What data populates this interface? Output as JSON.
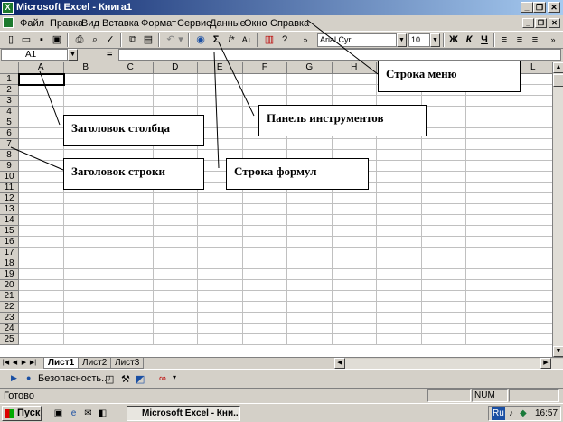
{
  "window": {
    "title": "Microsoft Excel - Книга1",
    "min_label": "_",
    "max_label": "❐",
    "close_label": "✕"
  },
  "menu": {
    "items": [
      "Файл",
      "Правка",
      "Вид",
      "Вставка",
      "Формат",
      "Сервис",
      "Данные",
      "Окно",
      "Справка"
    ]
  },
  "toolbar": {
    "font_name": "Arial Cyr",
    "font_size": "10",
    "bold": "Ж",
    "italic": "К",
    "underline": "Ч"
  },
  "formula_bar": {
    "name_box": "A1",
    "equals": "=",
    "value": ""
  },
  "grid": {
    "columns": [
      "A",
      "B",
      "C",
      "D",
      "E",
      "F",
      "G",
      "H",
      "I",
      "J",
      "K",
      "L"
    ],
    "rows": [
      "1",
      "2",
      "3",
      "4",
      "5",
      "6",
      "7",
      "8",
      "9",
      "10",
      "11",
      "12",
      "13",
      "14",
      "15",
      "16",
      "17",
      "18",
      "19",
      "20",
      "21",
      "22",
      "23",
      "24",
      "25"
    ],
    "active_cell": "A1"
  },
  "sheets": {
    "tabs": [
      "Лист1",
      "Лист2",
      "Лист3"
    ],
    "active": "Лист1"
  },
  "drawing_toolbar": {
    "security_label": "Безопасность..."
  },
  "status": {
    "text": "Готово",
    "num": "NUM"
  },
  "taskbar": {
    "start_label": "Пуск",
    "task_label": "Microsoft Excel - Кни...",
    "lang": "Ru",
    "clock": "16:57"
  },
  "callouts": {
    "menu_bar": "Строка меню",
    "column_header": "Заголовок столбца",
    "toolbar": "Панель инструментов",
    "row_header": "Заголовок строки",
    "formula_bar": "Строка формул"
  },
  "colors": {
    "title_start": "#0a246a",
    "title_end": "#a6caf0",
    "chrome": "#d4d0c8",
    "gridline": "#c0c0c0"
  }
}
